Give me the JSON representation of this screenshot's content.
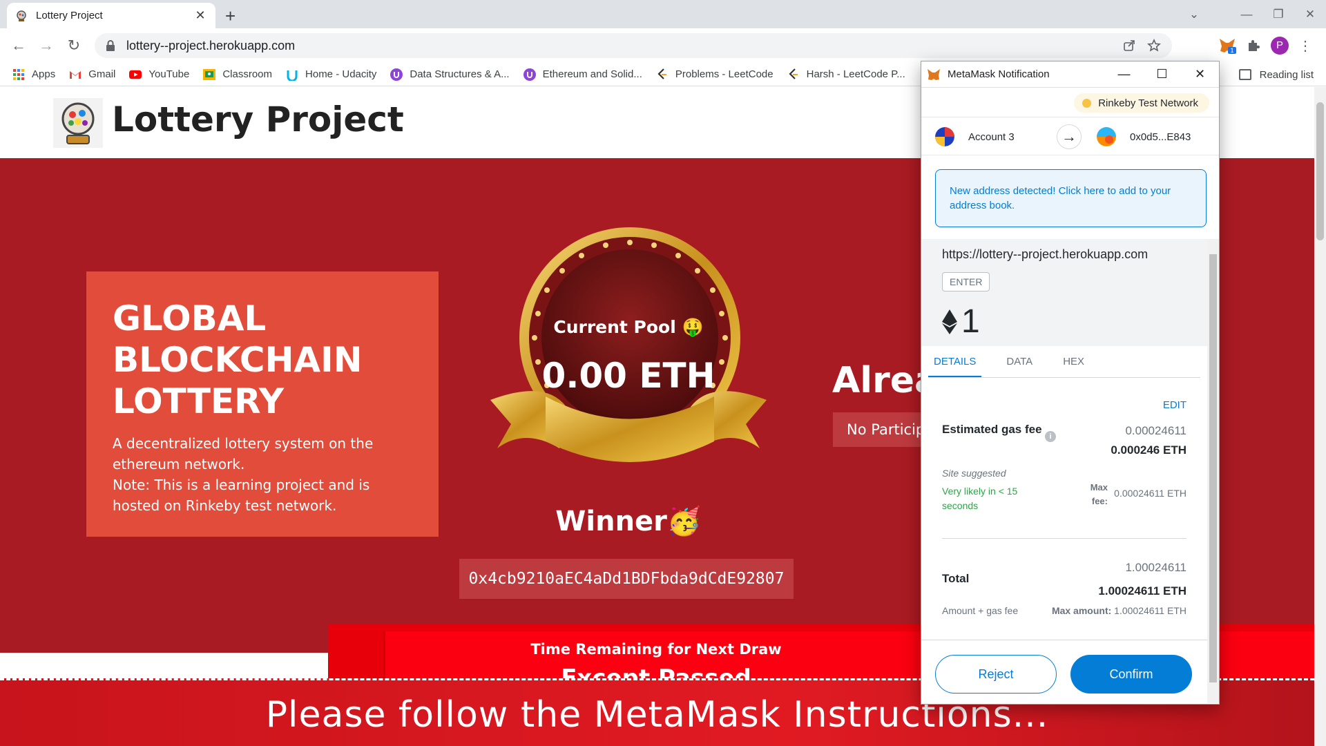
{
  "browser": {
    "tab_title": "Lottery Project",
    "url": "lottery--project.herokuapp.com",
    "bookmarks": [
      {
        "label": "Apps",
        "icon": "apps-grid-icon"
      },
      {
        "label": "Gmail",
        "icon": "gmail-icon"
      },
      {
        "label": "YouTube",
        "icon": "youtube-icon"
      },
      {
        "label": "Classroom",
        "icon": "classroom-icon"
      },
      {
        "label": "Home - Udacity",
        "icon": "udacity-icon"
      },
      {
        "label": "Data Structures & A...",
        "icon": "course-icon"
      },
      {
        "label": "Ethereum and Solid...",
        "icon": "course-icon"
      },
      {
        "label": "Problems - LeetCode",
        "icon": "leetcode-icon"
      },
      {
        "label": "Harsh - LeetCode P...",
        "icon": "leetcode-icon"
      }
    ],
    "reading_list": "Reading list",
    "profile_initial": "P",
    "extension_badge": "1"
  },
  "site": {
    "title": "Lottery Project",
    "intro_title": "GLOBAL BLOCKCHAIN LOTTERY",
    "intro_line1": "A decentralized lottery system on the ethereum network.",
    "intro_line2": "Note: This is a learning project and is hosted on Rinkeby test network.",
    "pool_label": "Current Pool 🤑",
    "pool_value": "0.00 ETH",
    "winner_label": "Winner🥳",
    "winner_address": "0x4cb9210aEC4aDd1BDFbda9dCdE92807",
    "already_heading": "Alrea",
    "participants_text": "No Particip",
    "timer_label": "Time Remaining for Next Draw",
    "timer_value": "Except Passed",
    "overlay_message": "Please follow the MetaMask Instructions..."
  },
  "metamask": {
    "window_title": "MetaMask Notification",
    "network": "Rinkeby Test Network",
    "from_account": "Account 3",
    "to_address": "0x0d5...E843",
    "alert": "New address detected! Click here to add to your address book.",
    "origin": "https://lottery--project.herokuapp.com",
    "method": "ENTER",
    "amount": "1",
    "tabs": [
      "DETAILS",
      "DATA",
      "HEX"
    ],
    "edit": "EDIT",
    "gas_title": "Estimated gas fee",
    "gas_secondary": "0.00024611",
    "gas_primary": "0.000246 ETH",
    "site_suggested": "Site suggested",
    "likely": "Very likely in < 15 seconds",
    "max_fee_label": "Max fee:",
    "max_fee_value": "0.00024611 ETH",
    "total_label": "Total",
    "total_secondary": "1.00024611",
    "total_primary": "1.00024611 ETH",
    "amount_gas_label": "Amount + gas fee",
    "max_amount_label": "Max amount:",
    "max_amount_value": "1.00024611 ETH",
    "reject": "Reject",
    "confirm": "Confirm"
  },
  "colors": {
    "hero_red": "#a91b22",
    "intro_box": "#e24c3b",
    "metamask_blue": "#037dd6",
    "success_green": "#28a745"
  }
}
